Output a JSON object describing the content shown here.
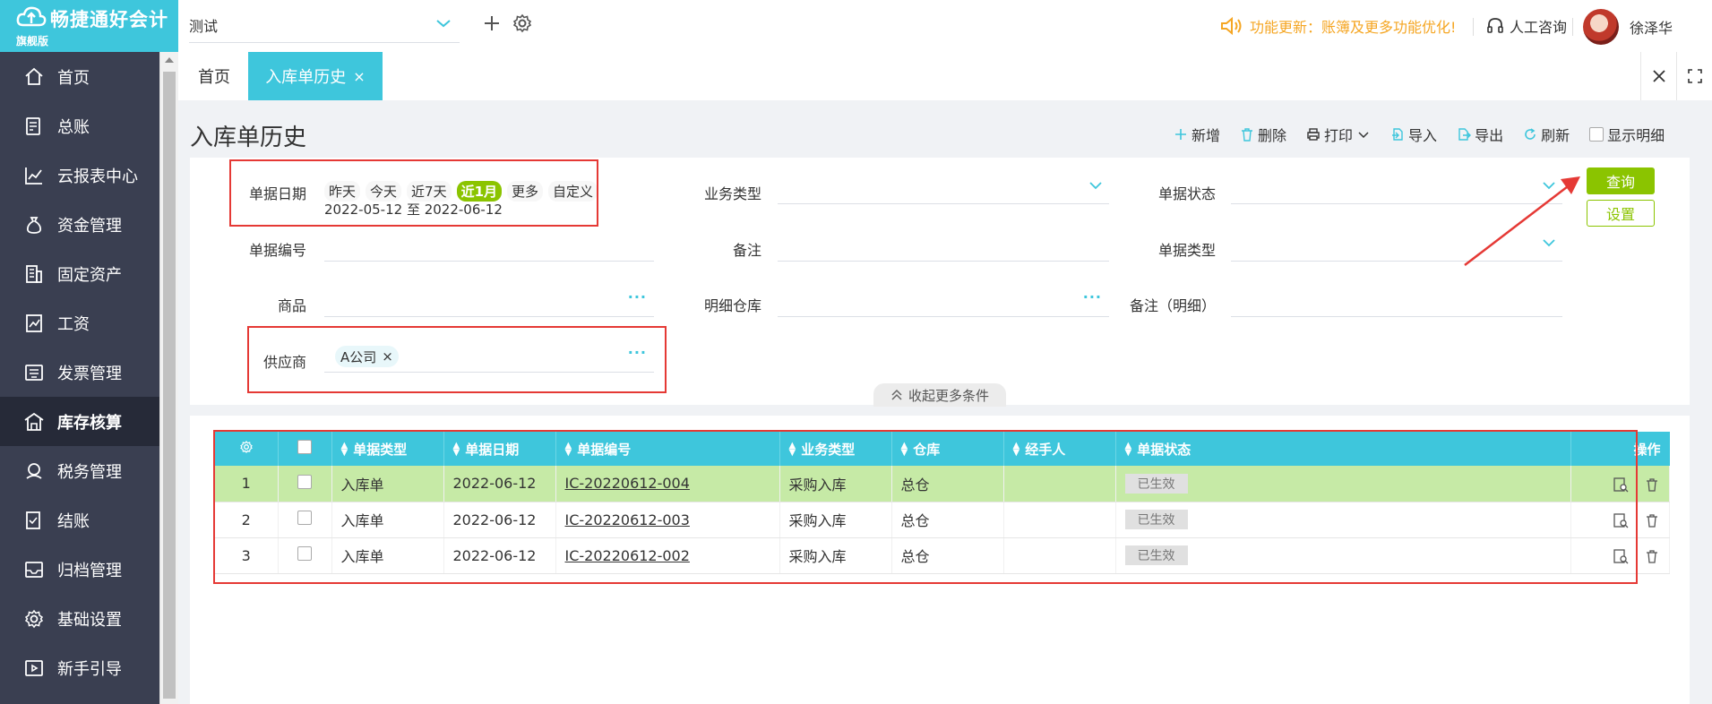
{
  "brand": {
    "name": "畅捷通好会计",
    "edition": "旗舰版"
  },
  "topbar": {
    "account": "测试",
    "notice": "功能更新：账簿及更多功能优化!",
    "consult": "人工咨询",
    "user": "徐泽华",
    "icons": [
      "chevron-down-icon",
      "plus-icon",
      "gear-icon",
      "speaker-icon",
      "headset-icon"
    ]
  },
  "sidebar": {
    "items": [
      {
        "label": "首页",
        "icon": "home-icon"
      },
      {
        "label": "总账",
        "icon": "ledger-icon"
      },
      {
        "label": "云报表中心",
        "icon": "chart-icon"
      },
      {
        "label": "资金管理",
        "icon": "money-icon"
      },
      {
        "label": "固定资产",
        "icon": "building-icon"
      },
      {
        "label": "工资",
        "icon": "salary-icon"
      },
      {
        "label": "发票管理",
        "icon": "invoice-icon"
      },
      {
        "label": "库存核算",
        "icon": "warehouse-icon",
        "active": true
      },
      {
        "label": "税务管理",
        "icon": "tax-icon"
      },
      {
        "label": "结账",
        "icon": "close-book-icon"
      },
      {
        "label": "归档管理",
        "icon": "archive-icon"
      },
      {
        "label": "基础设置",
        "icon": "gear-icon"
      },
      {
        "label": "新手引导",
        "icon": "guide-icon"
      }
    ]
  },
  "tabs": {
    "home": "首页",
    "active": "入库单历史",
    "close": "×"
  },
  "page": {
    "title": "入库单历史"
  },
  "toolbar": {
    "add": "新增",
    "delete": "删除",
    "print": "打印",
    "import": "导入",
    "export": "导出",
    "refresh": "刷新",
    "show_detail": "显示明细"
  },
  "filters": {
    "date_label": "单据日期",
    "quick": [
      "昨天",
      "今天",
      "近7天",
      "近1月",
      "更多",
      "自定义"
    ],
    "quick_active": "近1月",
    "range": "2022-05-12 至 2022-06-12",
    "biz_type_label": "业务类型",
    "status_label": "单据状态",
    "doc_no_label": "单据编号",
    "remark_label": "备注",
    "doc_type_label": "单据类型",
    "goods_label": "商品",
    "detail_wh_label": "明细仓库",
    "detail_remark_label": "备注（明细）",
    "supplier_label": "供应商",
    "supplier_tag": "A公司",
    "dots": "···",
    "query": "查询",
    "setting": "设置",
    "collapse": "收起更多条件"
  },
  "table": {
    "columns": [
      "单据类型",
      "单据日期",
      "单据编号",
      "业务类型",
      "仓库",
      "经手人",
      "单据状态"
    ],
    "ops_label": "操作",
    "rows": [
      {
        "idx": "1",
        "type": "入库单",
        "date": "2022-06-12",
        "no": "IC-20220612-004",
        "biz": "采购入库",
        "wh": "总仓",
        "handler": "",
        "status": "已生效"
      },
      {
        "idx": "2",
        "type": "入库单",
        "date": "2022-06-12",
        "no": "IC-20220612-003",
        "biz": "采购入库",
        "wh": "总仓",
        "handler": "",
        "status": "已生效"
      },
      {
        "idx": "3",
        "type": "入库单",
        "date": "2022-06-12",
        "no": "IC-20220612-002",
        "biz": "采购入库",
        "wh": "总仓",
        "handler": "",
        "status": "已生效"
      }
    ]
  },
  "colors": {
    "accent": "#3ec6dc",
    "sidebar": "#3a3f51",
    "green": "#8bc400",
    "highlight": "#e53935",
    "notice": "#f5a623"
  }
}
